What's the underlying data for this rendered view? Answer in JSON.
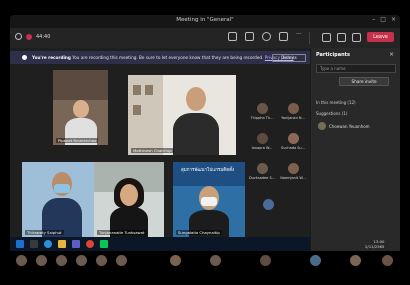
{
  "window": {
    "title": "Meeting in \"General\""
  },
  "toolbar": {
    "timer": "44:40",
    "leave_label": "Leave"
  },
  "banner": {
    "text_bold": "You're recording",
    "text": " You are recording this meeting. Be sure to let everyone know that they are being recorded.",
    "link": "Privacy policy",
    "dismiss": "Dismiss"
  },
  "tiles": [
    {
      "name": "Pipanet Rmmerchoo"
    },
    {
      "name": "Mathinesh Chaichup"
    },
    {
      "name": "Thirawaty Saiphut"
    },
    {
      "name": "Tunjananatie Tunksawat"
    },
    {
      "name": "Sungalatia Chaynaitip"
    }
  ],
  "tile_banner_text": "สุมการพัฒนาโปแกรมติดตั้ง",
  "grid_people": [
    {
      "name": "Thippha Th..."
    },
    {
      "name": "Yanijanan N..."
    },
    {
      "name": "Ianapra W..."
    },
    {
      "name": "Suchada Su..."
    },
    {
      "name": "Ducksadee S..."
    },
    {
      "name": "Naemjanit W..."
    }
  ],
  "participants": {
    "title": "Participants",
    "search_placeholder": "Type a name",
    "share_label": "Share invite",
    "in_meeting": "In this meeting (12)",
    "suggestions": "Suggestions (1)",
    "guest_name": "Choewan Yeuanhom"
  },
  "clock": {
    "time": "13:00",
    "date": "2/11/2565"
  },
  "colors": {
    "leave": "#c4314b",
    "banner": "#2f2f4a",
    "panel": "#292929"
  }
}
